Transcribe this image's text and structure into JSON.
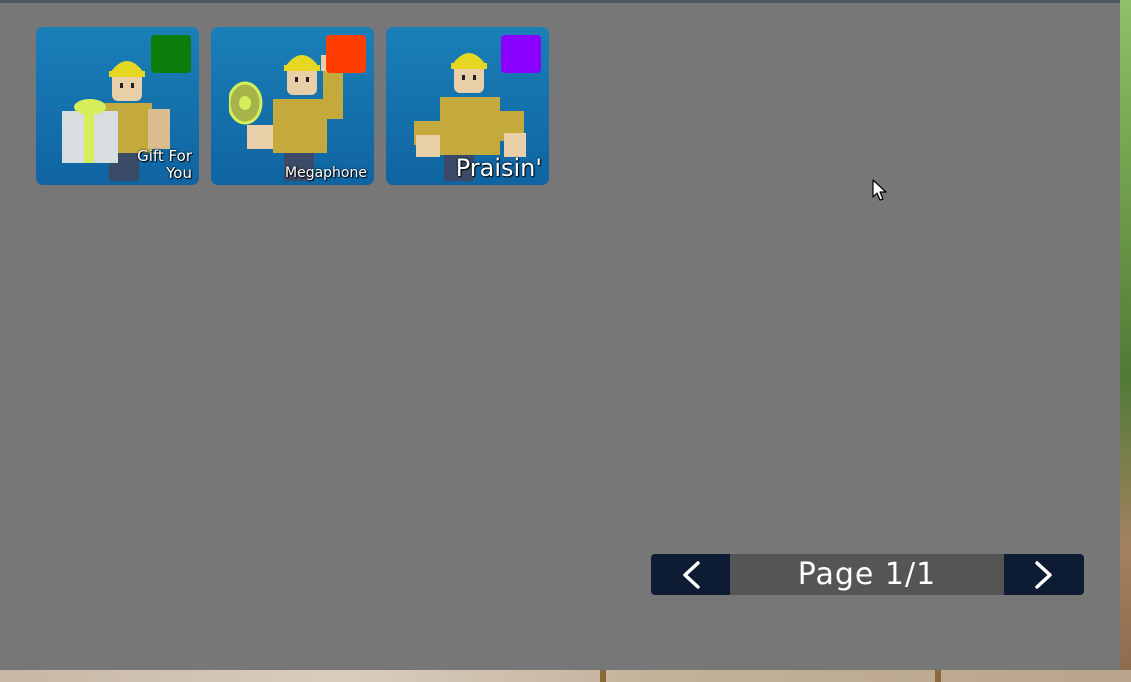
{
  "emotes": [
    {
      "label": "Gift For\nYou",
      "swatch_color": "#0a7d0a",
      "icon": "gift-for-you-figure"
    },
    {
      "label": "Megaphone",
      "swatch_color": "#ff3d00",
      "icon": "megaphone-figure"
    },
    {
      "label": "Praisin'",
      "swatch_color": "#8a00ff",
      "icon": "praisin-figure"
    }
  ],
  "pager": {
    "label": "Page 1/1",
    "prev_icon": "chevron-left-icon",
    "next_icon": "chevron-right-icon"
  },
  "colors": {
    "panel": "#777777",
    "card": "#1170ab",
    "pager_button": "#0d1b33",
    "pager_label": "#555555"
  }
}
